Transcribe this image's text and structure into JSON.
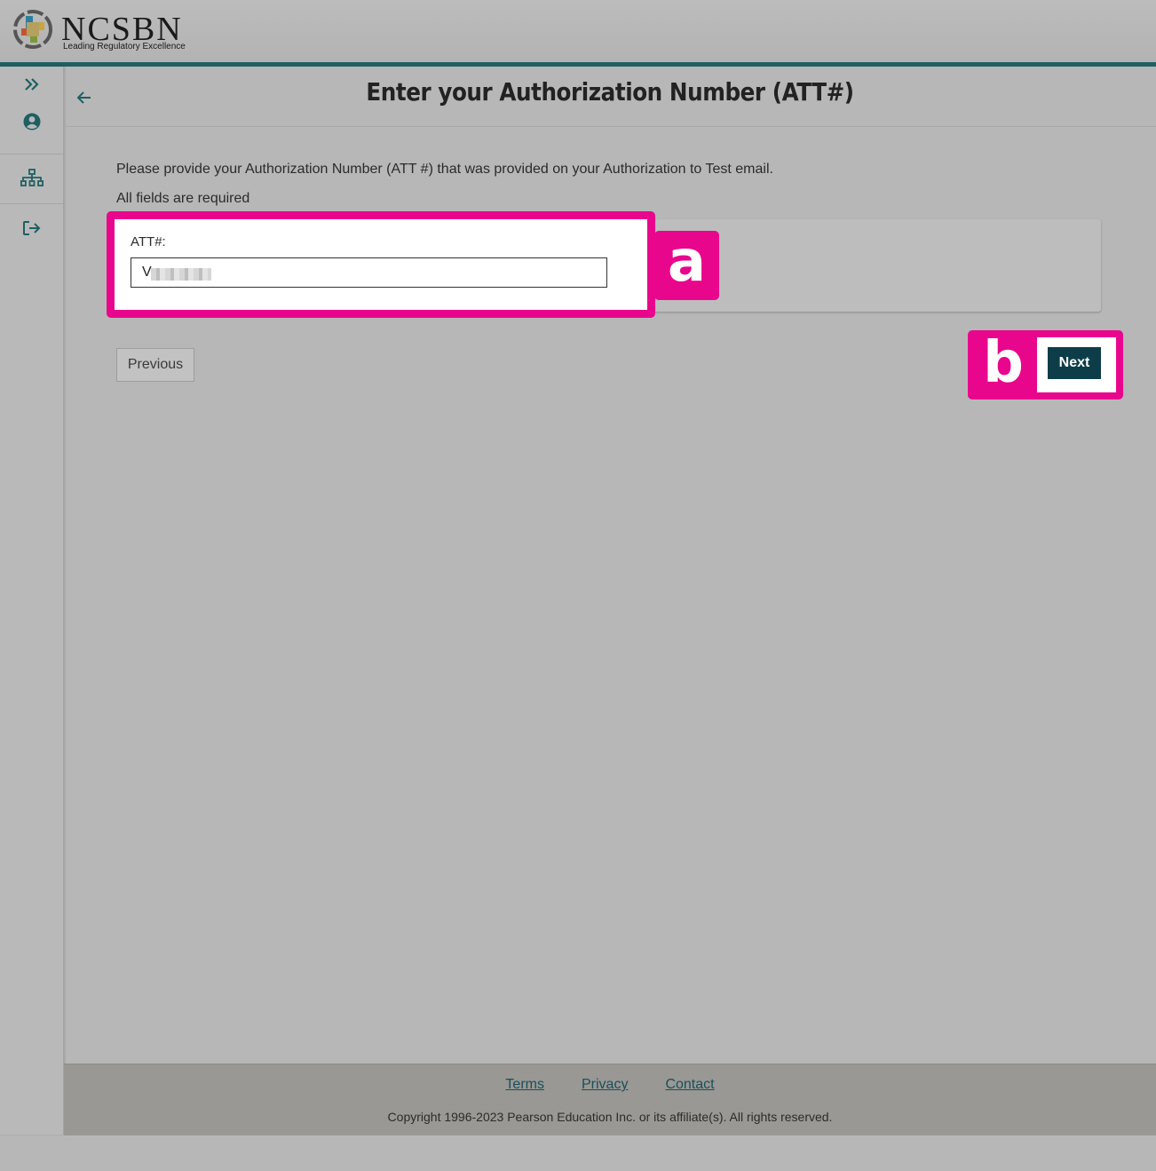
{
  "brand": {
    "name": "NCSBN",
    "tagline": "Leading Regulatory Excellence",
    "accent_color": "#1f5f62"
  },
  "sidebar": {
    "items": [
      {
        "name": "expand",
        "icon": "double-chevron-right-icon"
      },
      {
        "name": "profile",
        "icon": "user-circle-icon"
      },
      {
        "name": "sitemap",
        "icon": "sitemap-icon"
      },
      {
        "name": "logout",
        "icon": "sign-out-icon"
      }
    ]
  },
  "header": {
    "back_icon": "arrow-left-icon",
    "title": "Enter your Authorization Number (ATT#)"
  },
  "form": {
    "intro": "Please provide your Authorization Number (ATT #) that was provided on your Authorization to Test email.",
    "required_note": "All fields are required",
    "att_label": "ATT#:",
    "att_value": "V"
  },
  "annotations": {
    "a": "a",
    "b": "b",
    "highlight_color": "#e8078c"
  },
  "buttons": {
    "previous": "Previous",
    "next": "Next"
  },
  "footer": {
    "links": [
      "Terms",
      "Privacy",
      "Contact"
    ],
    "copyright": "Copyright 1996-2023 Pearson Education Inc. or its affiliate(s). All rights reserved."
  }
}
